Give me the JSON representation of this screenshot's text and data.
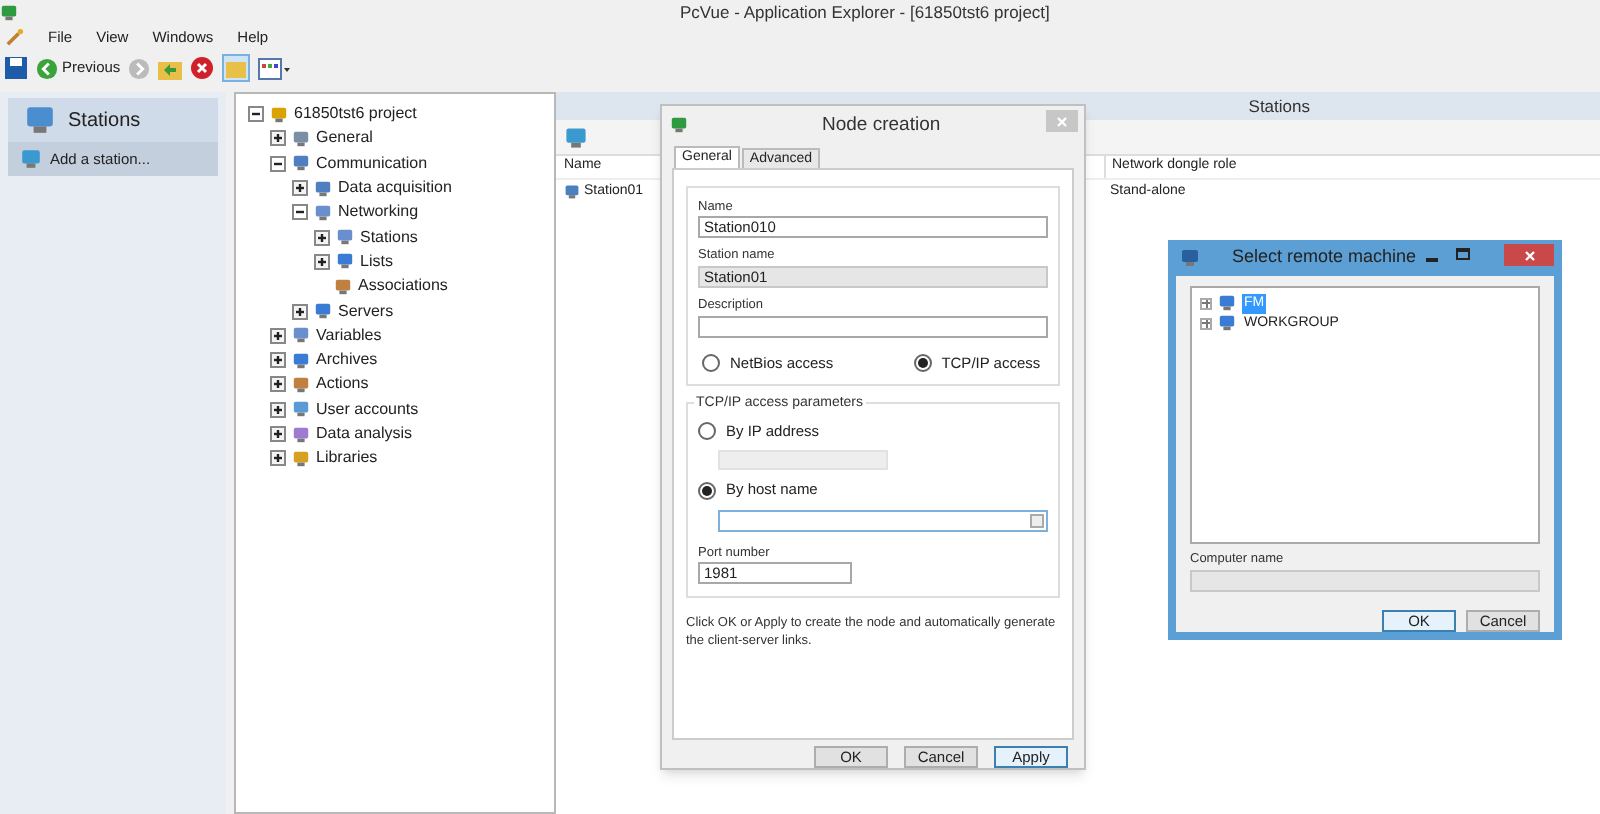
{
  "window": {
    "title": "PcVue - Application Explorer - [61850tst6 project]"
  },
  "menu": [
    "File",
    "View",
    "Windows",
    "Help"
  ],
  "toolbar": {
    "back_label": "Previous"
  },
  "left_panel": {
    "title": "Stations",
    "items": [
      {
        "label": "Add a station...",
        "selected": true
      }
    ]
  },
  "tree": [
    {
      "label": "61850tst6 project",
      "kind": "folder",
      "expanded": true,
      "children": [
        {
          "label": "General",
          "kind": "folder",
          "expanded": false
        },
        {
          "label": "Communication",
          "kind": "folder",
          "expanded": true,
          "children": [
            {
              "label": "Data acquisition",
              "kind": "folder",
              "expanded": false
            },
            {
              "label": "Networking",
              "kind": "folder",
              "expanded": true,
              "children": [
                {
                  "label": "Stations",
                  "kind": "folder",
                  "expanded": false
                },
                {
                  "label": "Lists",
                  "kind": "folder",
                  "expanded": false
                },
                {
                  "label": "Associations",
                  "kind": "leaf"
                }
              ]
            },
            {
              "label": "Servers",
              "kind": "folder",
              "expanded": false
            }
          ]
        },
        {
          "label": "Variables",
          "kind": "folder",
          "expanded": false
        },
        {
          "label": "Archives",
          "kind": "folder",
          "expanded": false
        },
        {
          "label": "Actions",
          "kind": "folder",
          "expanded": false
        },
        {
          "label": "User accounts",
          "kind": "folder",
          "expanded": false
        },
        {
          "label": "Data analysis",
          "kind": "folder",
          "expanded": false
        },
        {
          "label": "Libraries",
          "kind": "folder",
          "expanded": false
        }
      ]
    }
  ],
  "stations_panel": {
    "title": "Stations",
    "columns": [
      "Name",
      "Network dongle role"
    ],
    "rows": [
      [
        "Station01",
        "Stand-alone"
      ]
    ]
  },
  "node_dialog": {
    "title": "Node creation",
    "tabs": [
      {
        "label": "General",
        "selected": true
      },
      {
        "label": "Advanced",
        "selected": false
      }
    ],
    "name": {
      "label": "Name",
      "value": "Station010",
      "disabled": false
    },
    "station_name": {
      "label": "Station name",
      "value": "Station01",
      "disabled": true
    },
    "description": {
      "label": "Description",
      "disabled": false
    },
    "access": [
      {
        "label": "NetBios access",
        "selected": false
      },
      {
        "label": "TCP/IP access",
        "selected": true
      }
    ],
    "tcp_group": {
      "title": "TCP/IP access parameters",
      "by_ip": {
        "label": "By IP address",
        "selected": false
      },
      "by_host": {
        "label": "By host name",
        "selected": true
      },
      "port": {
        "label": "Port number",
        "value": "1981"
      }
    },
    "note": "Click OK or Apply to create the node and automatically generate the client-server links.",
    "buttons": [
      {
        "label": "OK",
        "default": false
      },
      {
        "label": "Cancel",
        "default": false
      },
      {
        "label": "Apply",
        "default": true
      }
    ]
  },
  "remote_dialog": {
    "title": "Select remote machine",
    "tree": [
      {
        "label": "FM",
        "selected": true
      },
      {
        "label": "WORKGROUP",
        "selected": false
      }
    ],
    "computer_name": {
      "label": "Computer name",
      "disabled": true
    },
    "buttons": [
      {
        "label": "OK",
        "default": true
      },
      {
        "label": "Cancel",
        "default": false
      }
    ]
  }
}
